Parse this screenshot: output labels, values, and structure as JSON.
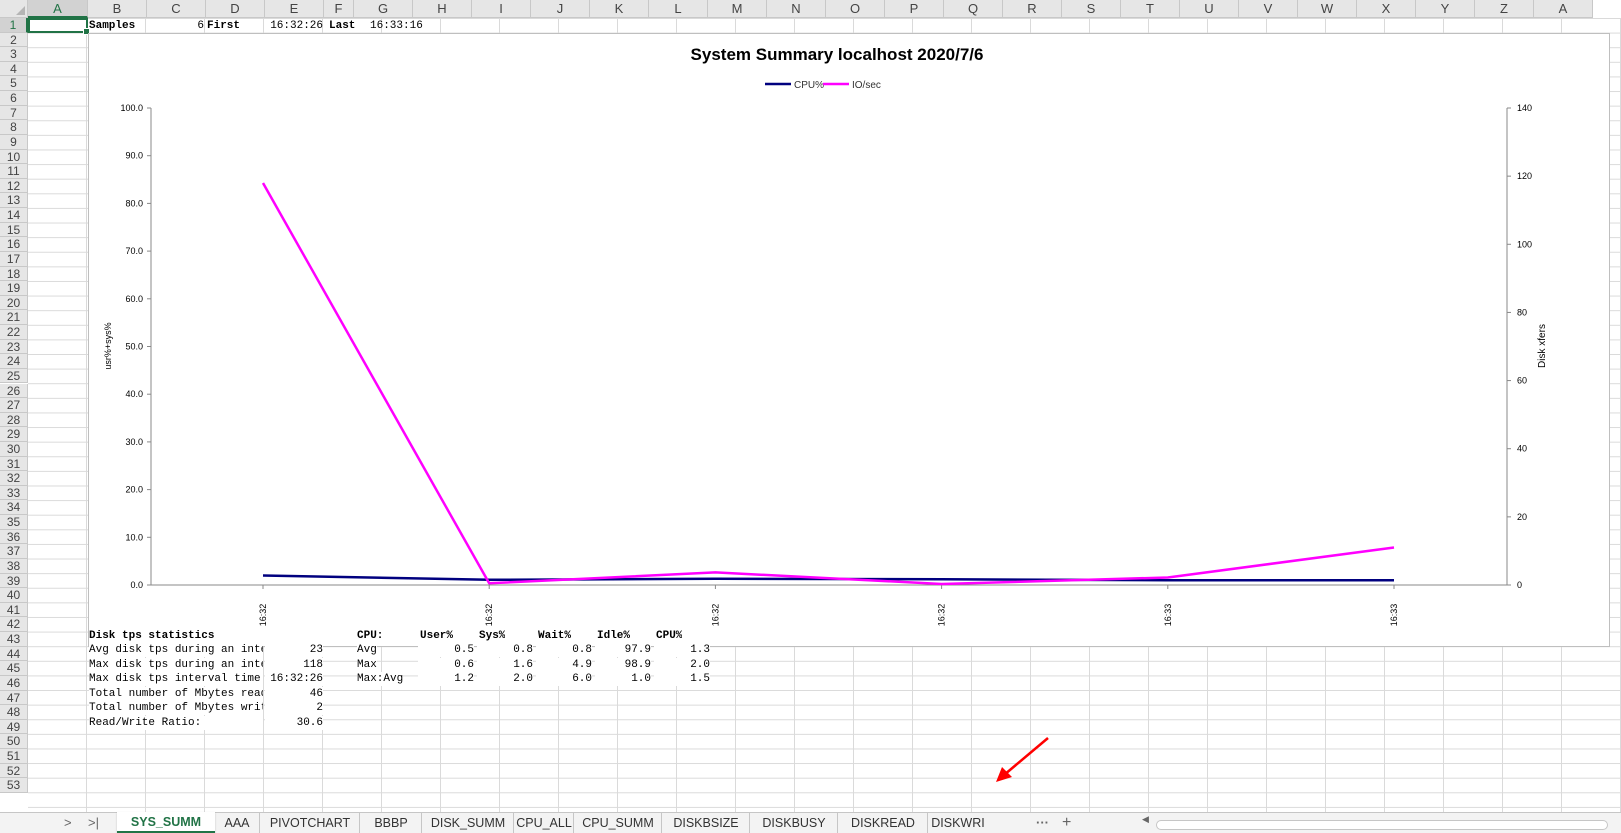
{
  "columns": [
    "A",
    "B",
    "C",
    "D",
    "E",
    "F",
    "G",
    "H",
    "I",
    "J",
    "K",
    "L",
    "M",
    "N",
    "O",
    "P",
    "Q",
    "R",
    "S",
    "T",
    "U",
    "V",
    "W",
    "X",
    "Y",
    "Z",
    "A"
  ],
  "rows": [
    "1",
    "2",
    "3",
    "4",
    "5",
    "6",
    "7",
    "8",
    "9",
    "10",
    "11",
    "12",
    "13",
    "14",
    "15",
    "16",
    "17",
    "18",
    "19",
    "20",
    "21",
    "22",
    "23",
    "24",
    "25",
    "26",
    "27",
    "28",
    "29",
    "30",
    "31",
    "32",
    "33",
    "34",
    "35",
    "36",
    "37",
    "38",
    "39",
    "40",
    "41",
    "42",
    "43",
    "44",
    "45",
    "46",
    "47",
    "48",
    "49",
    "50",
    "51",
    "52",
    "53"
  ],
  "selected": {
    "column": "A",
    "row": "1"
  },
  "header_row": {
    "samples_label": "Samples",
    "samples_value": "6",
    "first_label": "First",
    "first_value": "16:32:26",
    "last_label": "Last",
    "last_value": "16:33:16"
  },
  "disk_stats": {
    "title": "Disk tps statistics",
    "rows": [
      {
        "label": "Avg disk tps during an interva",
        "value": "23"
      },
      {
        "label": "Max disk tps during an interva",
        "value": "118"
      },
      {
        "label": "Max disk tps interval time:",
        "value": "16:32:26"
      },
      {
        "label": "Total number of Mbytes read:",
        "value": "46"
      },
      {
        "label": "Total number of Mbytes written",
        "value": "2"
      },
      {
        "label": "Read/Write Ratio:",
        "value": "30.6"
      }
    ]
  },
  "cpu_stats": {
    "headers": [
      "CPU:",
      "User%",
      "Sys%",
      "Wait%",
      "Idle%",
      "CPU%"
    ],
    "rows": [
      [
        "Avg",
        "0.5",
        "0.8",
        "0.8",
        "97.9",
        "1.3"
      ],
      [
        "Max",
        "0.6",
        "1.6",
        "4.9",
        "98.9",
        "2.0"
      ],
      [
        "Max:Avg",
        "1.2",
        "2.0",
        "6.0",
        "1.0",
        "1.5"
      ]
    ]
  },
  "chart_data": {
    "type": "line",
    "title": "System Summary localhost  2020/7/6",
    "x": [
      "16:32",
      "16:32",
      "16:32",
      "16:32",
      "16:33",
      "16:33"
    ],
    "series": [
      {
        "name": "CPU%",
        "axis": "left",
        "color": "#00007f",
        "values": [
          2.0,
          1.1,
          1.3,
          1.2,
          1.0,
          1.0
        ]
      },
      {
        "name": "IO/sec",
        "axis": "right",
        "color": "#ff00ff",
        "values": [
          118,
          0.5,
          3.7,
          0.3,
          2.2,
          11
        ]
      }
    ],
    "ylabel": "usr%+sys%",
    "y2label": "Disk xfers",
    "ylim": [
      0,
      100
    ],
    "y2lim": [
      0,
      140
    ],
    "yticks": [
      "0.0",
      "10.0",
      "20.0",
      "30.0",
      "40.0",
      "50.0",
      "60.0",
      "70.0",
      "80.0",
      "90.0",
      "100.0"
    ],
    "y2ticks": [
      "0",
      "20",
      "40",
      "60",
      "80",
      "100",
      "120",
      "140"
    ],
    "legend": "top-center",
    "grid": false
  },
  "sheet_tabs": [
    "SYS_SUMM",
    "AAA",
    "PIVOTCHART",
    "BBBP",
    "DISK_SUMM",
    "CPU_ALL",
    "CPU_SUMM",
    "DISKBSIZE",
    "DISKBUSY",
    "DISKREAD",
    "DISKWRI"
  ],
  "active_tab": "SYS_SUMM",
  "sheet_nav": {
    "next": ">",
    "last": ">|",
    "more": "···",
    "add": "+"
  },
  "colors": {
    "accent": "#217346",
    "annotation_arrow": "#ff0000"
  }
}
